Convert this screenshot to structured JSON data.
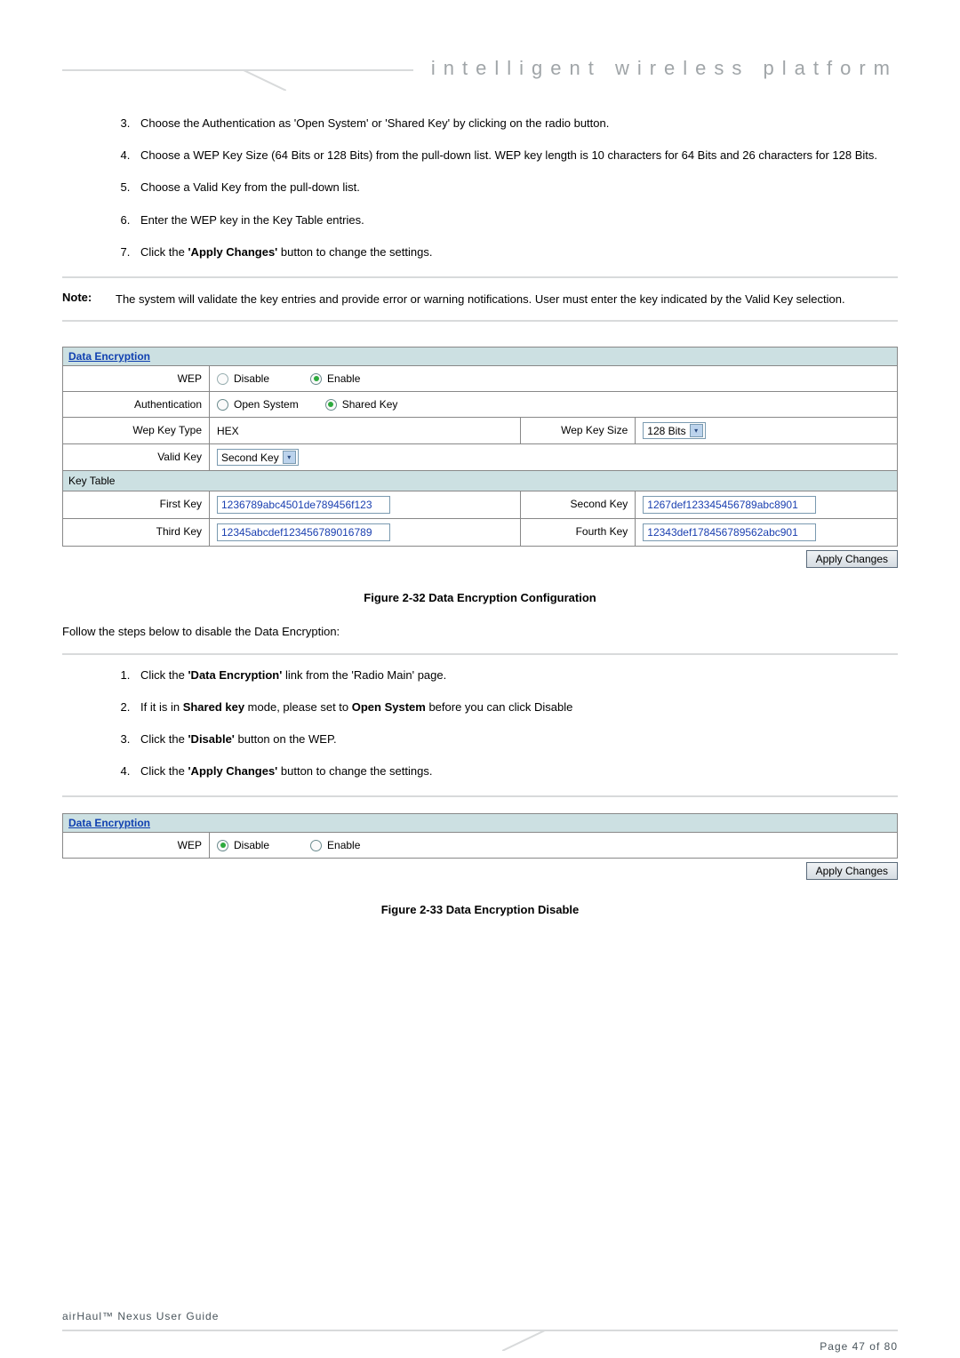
{
  "header": {
    "tagline": "intelligent  wireless  platform"
  },
  "steps1": [
    "Choose the Authentication as 'Open System' or 'Shared Key' by clicking on the radio button.",
    "Choose a WEP Key Size (64 Bits or 128 Bits) from the pull-down list. WEP key length is 10 characters for 64 Bits and 26 characters for 128 Bits.",
    "Choose a Valid Key from the pull-down list.",
    "Enter the WEP key in the Key Table entries.",
    "Click the 'Apply Changes' button to change the settings."
  ],
  "note": {
    "label": "Note:",
    "text": "The system will validate the key entries and provide error or warning notifications. User must enter the key indicated by the Valid Key selection."
  },
  "config1": {
    "title": "Data Encryption",
    "rows": {
      "wep": {
        "label": "WEP",
        "opt1": "Disable",
        "opt2": "Enable"
      },
      "auth": {
        "label": "Authentication",
        "opt1": "Open System",
        "opt2": "Shared Key"
      },
      "wepkeytype": {
        "label": "Wep Key Type",
        "value": "HEX",
        "sizelabel": "Wep Key Size",
        "sizevalue": "128 Bits"
      },
      "validkey": {
        "label": "Valid Key",
        "value": "Second Key"
      },
      "keytable": "Key Table",
      "first": {
        "label": "First Key",
        "value": "1236789abc4501de789456f123"
      },
      "second": {
        "label": "Second Key",
        "value": "1267def123345456789abc8901"
      },
      "third": {
        "label": "Third Key",
        "value": "12345abcdef123456789016789"
      },
      "fourth": {
        "label": "Fourth Key",
        "value": "12343def178456789562abc901"
      }
    },
    "apply": "Apply Changes"
  },
  "caption1": "Figure 2-32 Data Encryption Configuration",
  "followtext": "Follow the steps below to disable the Data Encryption:",
  "steps2": [
    {
      "pre": "Click the ",
      "bold": "'Data Encryption'",
      "post": " link from the 'Radio Main' page."
    },
    {
      "pre": "If it is in ",
      "bold": "Shared key",
      "mid": " mode, please set to ",
      "bold2": "Open System",
      "post": " before you can click Disable"
    },
    {
      "pre": "Click the ",
      "bold": "'Disable'",
      "post": " button on the WEP."
    },
    {
      "pre": "Click the ",
      "bold": "'Apply Changes'",
      "post": " button to change the settings."
    }
  ],
  "config2": {
    "title": "Data Encryption",
    "wep": {
      "label": "WEP",
      "opt1": "Disable",
      "opt2": "Enable"
    },
    "apply": "Apply Changes"
  },
  "caption2": "Figure 2-33 Data Encryption Disable",
  "footer": {
    "left": "airHaul™ Nexus User Guide",
    "right": "Page 47 of 80"
  }
}
